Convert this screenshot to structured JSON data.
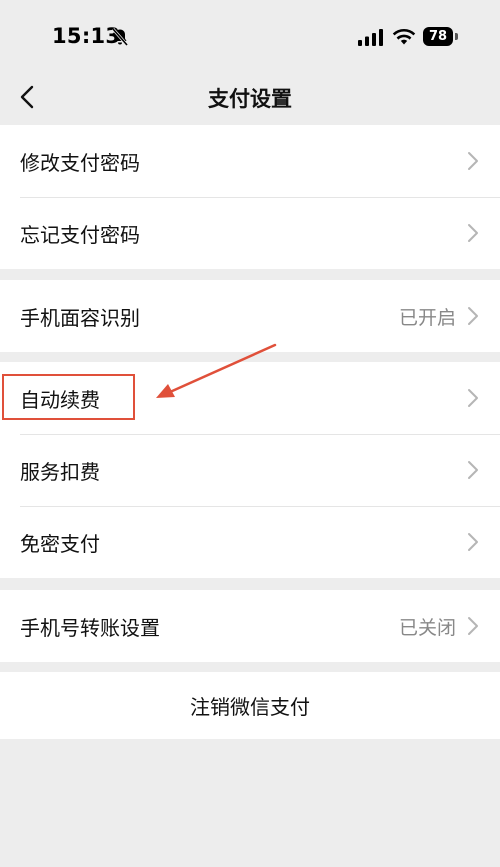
{
  "status_bar": {
    "time": "15:13",
    "battery": "78",
    "icons": [
      "bell-muted-icon",
      "signal-icon",
      "wifi-icon",
      "battery-icon"
    ]
  },
  "nav": {
    "title": "支付设置",
    "back_icon": "chevron-left-icon"
  },
  "groups": [
    {
      "items": [
        {
          "label": "修改支付密码",
          "value": ""
        },
        {
          "label": "忘记支付密码",
          "value": ""
        }
      ]
    },
    {
      "items": [
        {
          "label": "手机面容识别",
          "value": "已开启"
        }
      ]
    },
    {
      "items": [
        {
          "label": "自动续费",
          "value": ""
        },
        {
          "label": "服务扣费",
          "value": ""
        },
        {
          "label": "免密支付",
          "value": ""
        }
      ]
    },
    {
      "items": [
        {
          "label": "手机号转账设置",
          "value": "已关闭"
        }
      ]
    }
  ],
  "logout": {
    "label": "注销微信支付"
  },
  "annotation": {
    "highlight_color": "#e0503a"
  }
}
